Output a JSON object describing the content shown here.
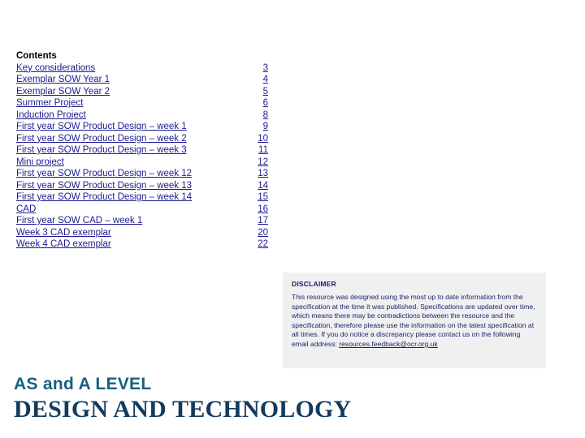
{
  "contents": {
    "heading": "Contents",
    "items": [
      {
        "label": "Key considerations",
        "page": "3"
      },
      {
        "label": "Exemplar SOW Year 1",
        "page": "4"
      },
      {
        "label": "Exemplar SOW Year 2",
        "page": "5"
      },
      {
        "label": "Summer Project",
        "page": "6"
      },
      {
        "label": "Induction Project",
        "page": "8"
      },
      {
        "label": "First year SOW Product Design – week 1",
        "page": "9"
      },
      {
        "label": "First year SOW Product Design – week 2",
        "page": "10"
      },
      {
        "label": "First year SOW Product Design – week 3",
        "page": "11"
      },
      {
        "label": "Mini project",
        "page": "12"
      },
      {
        "label": "First year SOW Product Design – week 12",
        "page": "13"
      },
      {
        "label": "First year SOW Product Design – week 13",
        "page": "14"
      },
      {
        "label": "First year SOW Product Design – week 14",
        "page": "15"
      },
      {
        "label": "CAD",
        "page": "16"
      },
      {
        "label": "First year SOW CAD – week 1",
        "page": "17"
      },
      {
        "label": "Week 3 CAD exemplar",
        "page": "20"
      },
      {
        "label": "Week 4 CAD exemplar",
        "page": "22"
      }
    ]
  },
  "disclaimer": {
    "title": "DISCLAIMER",
    "body": "This resource was designed using the most up to date information from the specification at the time it was published. Specifications are updated over time, which means there may be contradictions between the resource and the specification, therefore please use the information on the latest specification at all times. If you do notice a discrepancy please contact us on the following email address: ",
    "email": "resources.feedback@ocr.org.uk"
  },
  "footer": {
    "line1": "AS and A LEVEL",
    "line2": "DESIGN AND TECHNOLOGY"
  },
  "colors": {
    "link": "#1b1b8f",
    "disclaimer_bg": "#eff0f0",
    "brand_teal": "#18607f",
    "brand_navy": "#143a5e"
  }
}
